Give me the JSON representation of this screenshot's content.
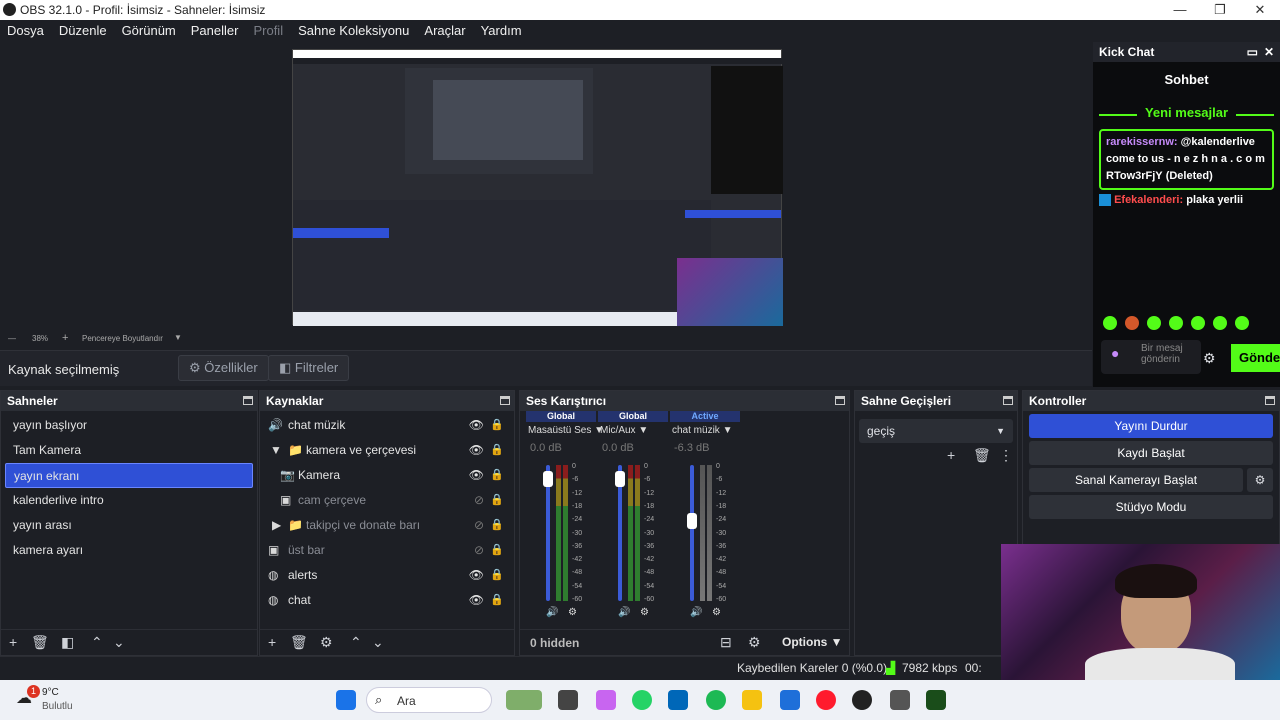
{
  "window": {
    "title": "OBS 32.1.0 - Profil: İsimsiz - Sahneler: İsimsiz"
  },
  "menu": [
    "Dosya",
    "Düzenle",
    "Görünüm",
    "Paneller",
    "Profil",
    "Sahne Koleksiyonu",
    "Araçlar",
    "Yardım"
  ],
  "preview": {
    "zoom": "38%",
    "fit_label": "Pencereye Boyutlandır"
  },
  "source_bar": {
    "label": "Kaynak seçilmemiş",
    "properties": "Özellikler",
    "filters": "Filtreler"
  },
  "scenes": {
    "title": "Sahneler",
    "items": [
      "yayın başlıyor",
      "Tam Kamera",
      "yayın ekranı",
      "kalenderlive intro",
      "yayın arası",
      "kamera ayarı"
    ],
    "selected_index": 2
  },
  "sources": {
    "title": "Kaynaklar",
    "items": [
      {
        "name": "chat müzik",
        "icon": "speaker-icon",
        "visible": true
      },
      {
        "name": "kamera ve çerçevesi",
        "icon": "folder-icon",
        "visible": true,
        "group": "expanded"
      },
      {
        "name": "Kamera",
        "icon": "camera-icon",
        "visible": true
      },
      {
        "name": "cam çerçeve",
        "icon": "image-icon",
        "visible": false
      },
      {
        "name": "takipçi ve donate barı",
        "icon": "folder-icon",
        "visible": false,
        "group": "collapsed"
      },
      {
        "name": "üst bar",
        "icon": "image-icon",
        "visible": false
      },
      {
        "name": "alerts",
        "icon": "globe-icon",
        "visible": true
      },
      {
        "name": "chat",
        "icon": "globe-icon",
        "visible": true
      }
    ]
  },
  "mixer": {
    "title": "Ses Karıştırıcı",
    "channels": [
      {
        "tag": "Global",
        "name": "Masaüstü Ses",
        "db": "0.0 dB",
        "level": 0.95
      },
      {
        "tag": "Global",
        "name": "Mic/Aux",
        "db": "0.0 dB",
        "level": 0.95
      },
      {
        "tag": "Active",
        "name": "chat müzik",
        "db": "-6.3 dB",
        "level": 0.6
      }
    ],
    "scale": [
      "0",
      "-6",
      "-12",
      "-18",
      "-24",
      "-30",
      "-36",
      "-42",
      "-48",
      "-54",
      "-60"
    ],
    "hidden": "0 hidden",
    "options": "Options"
  },
  "transitions": {
    "title": "Sahne Geçişleri",
    "selected": "geçiş"
  },
  "controls": {
    "title": "Kontroller",
    "buttons": [
      "Yayını Durdur",
      "Kaydı Başlat",
      "Sanal Kamerayı Başlat",
      "Stüdyo Modu"
    ]
  },
  "chat": {
    "title": "Kick Chat",
    "subtitle": "Sohbet",
    "new_messages": "Yeni mesajlar",
    "messages": [
      {
        "user": "rarekissernw:",
        "text": "@kalenderlive come to us - n e z h n a . c o m RTow3rFjY",
        "note": "(Deleted)"
      },
      {
        "user": "Efekalenderi:",
        "text": "plaka yerlii"
      }
    ],
    "input_placeholder": "Bir mesaj gönderin",
    "send": "Gönder"
  },
  "status": {
    "dropped": "Kaybedilen Kareler 0 (%0.0)",
    "bitrate": "7982 kbps",
    "time": "00:"
  },
  "taskbar": {
    "temp": "9°C",
    "weather": "Bulutlu",
    "search": "Ara",
    "badge": "1"
  },
  "colors": {
    "accent": "#2f50d6",
    "kick_green": "#53fc18",
    "chat_user": "#c58af9",
    "chat_user2": "#ff4d4d"
  }
}
